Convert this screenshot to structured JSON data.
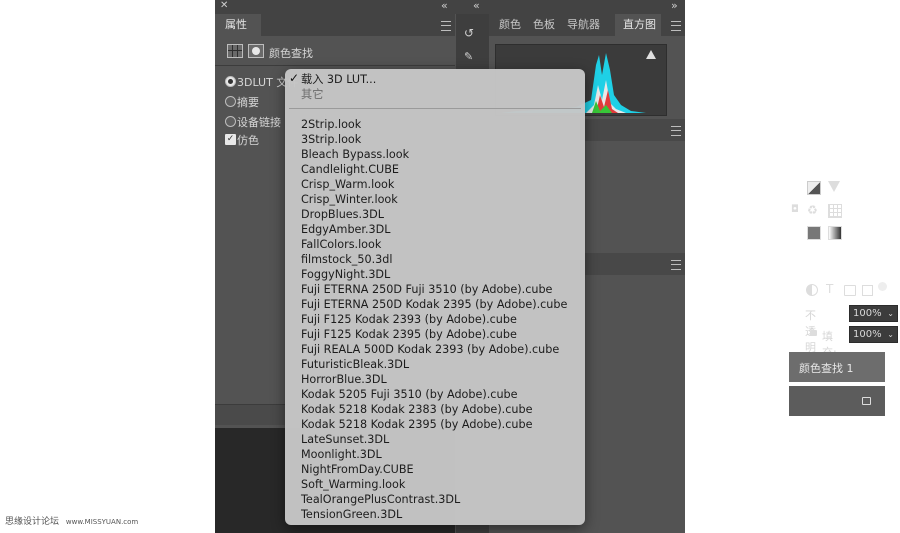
{
  "left_panel": {
    "close_glyph": "✕",
    "collapse_glyph": "«",
    "tab_label": "属性",
    "adjustment_title": "颜色查找",
    "options": [
      {
        "label": "3DLUT 文件",
        "type": "radio",
        "selected": true
      },
      {
        "label": "摘要",
        "type": "radio",
        "selected": false
      },
      {
        "label": "设备链接",
        "type": "radio",
        "selected": false
      },
      {
        "label": "仿色",
        "type": "checkbox",
        "checked": true
      }
    ]
  },
  "right_panel": {
    "collapse_glyph": "»",
    "tabs": [
      "颜色",
      "色板",
      "导航器",
      "直方图"
    ],
    "active_tab": "直方图",
    "opacity_label": "不透明度:",
    "opacity_value": "100%",
    "fill_label": "填充:",
    "fill_value": "100%",
    "layer_name": "颜色查找 1"
  },
  "dropdown": {
    "load_label": "载入 3D LUT...",
    "other_label": "其它",
    "check_glyph": "✓",
    "items": [
      "2Strip.look",
      "3Strip.look",
      "Bleach Bypass.look",
      "Candlelight.CUBE",
      "Crisp_Warm.look",
      "Crisp_Winter.look",
      "DropBlues.3DL",
      "EdgyAmber.3DL",
      "FallColors.look",
      "filmstock_50.3dl",
      "FoggyNight.3DL",
      "Fuji ETERNA 250D Fuji 3510 (by Adobe).cube",
      "Fuji ETERNA 250D Kodak 2395 (by Adobe).cube",
      "Fuji F125 Kodak 2393 (by Adobe).cube",
      "Fuji F125 Kodak 2395 (by Adobe).cube",
      "Fuji REALA 500D Kodak 2393 (by Adobe).cube",
      "FuturisticBleak.3DL",
      "HorrorBlue.3DL",
      "Kodak 5205 Fuji 3510 (by Adobe).cube",
      "Kodak 5218 Kodak 2383 (by Adobe).cube",
      "Kodak 5218 Kodak 2395 (by Adobe).cube",
      "LateSunset.3DL",
      "Moonlight.3DL",
      "NightFromDay.CUBE",
      "Soft_Warming.look",
      "TealOrangePlusContrast.3DL",
      "TensionGreen.3DL"
    ]
  },
  "watermark": {
    "site_name": "思缘设计论坛",
    "url": "www.MISSYUAN.com"
  },
  "colors": {
    "panel_bg": "#535353",
    "tab_bar_bg": "#434343",
    "menu_bg": "#c6c6c6",
    "menu_text": "#1c1c1c"
  }
}
